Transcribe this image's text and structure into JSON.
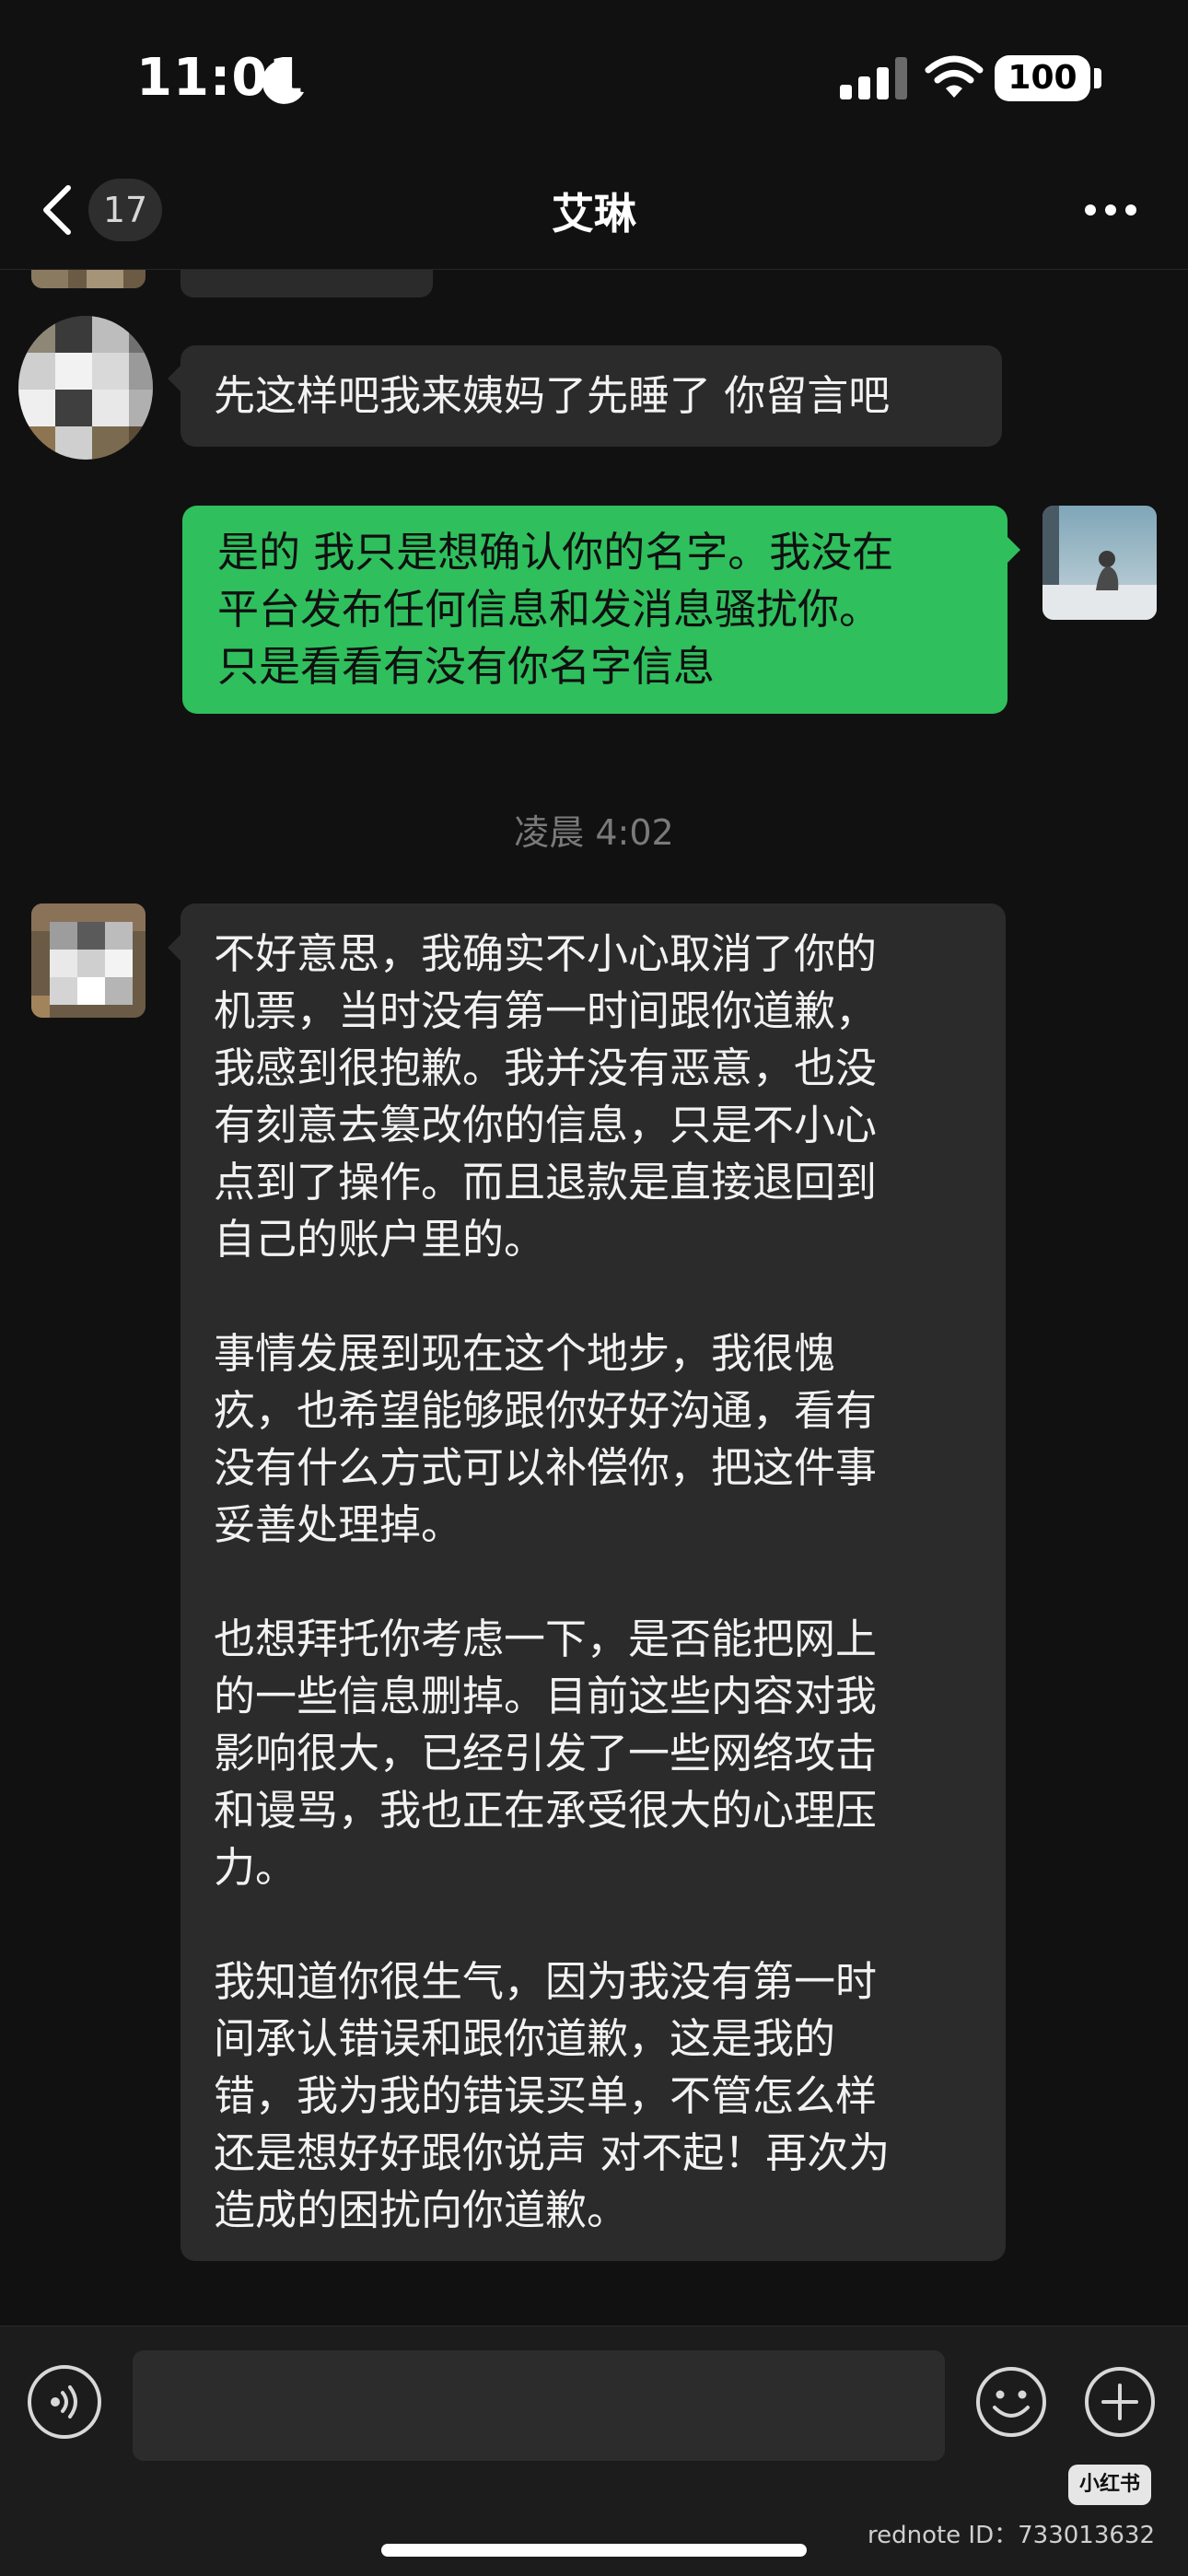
{
  "status_bar": {
    "time": "11:01",
    "battery": "100"
  },
  "nav": {
    "unread_count": "17",
    "title": "艾琳"
  },
  "messages": [
    {
      "from": "contact",
      "text": "先这样吧我来姨妈了先睡了 你留言吧"
    },
    {
      "from": "me",
      "text": "是的 我只是想确认你的名字。我没在\n平台发布任何信息和发消息骚扰你。\n只是看看有没有你名字信息"
    },
    {
      "from": "contact",
      "text": "不好意思，我确实不小心取消了你的\n机票，当时没有第一时间跟你道歉，\n我感到很抱歉。我并没有恶意，也没\n有刻意去篡改你的信息，只是不小心\n点到了操作。而且退款是直接退回到\n自己的账户里的。\n\n事情发展到现在这个地步，我很愧\n疚，也希望能够跟你好好沟通，看有\n没有什么方式可以补偿你，把这件事\n妥善处理掉。\n\n也想拜托你考虑一下，是否能把网上\n的一些信息删掉。目前这些内容对我\n影响很大，已经引发了一些网络攻击\n和谩骂，我也正在承受很大的心理压\n力。\n\n我知道你很生气，因为我没有第一时\n间承认错误和跟你道歉，这是我的\n错，我为我的错误买单，不管怎么样\n还是想好好跟你说声 对不起！再次为\n造成的困扰向你道歉。"
    }
  ],
  "timestamp": "凌晨 4:02",
  "input": {
    "placeholder": ""
  },
  "icons": [
    "moon-icon",
    "signal-icon",
    "wifi-icon",
    "back-chevron-icon",
    "more-icon",
    "voice-icon",
    "emoji-icon",
    "plus-icon"
  ],
  "watermark": {
    "logo": "小红书",
    "text": "rednote ID：733013632"
  },
  "colors": {
    "background": "#111111",
    "incoming_bubble": "#2b2b2b",
    "outgoing_bubble": "#2fbf5d",
    "timestamp": "#7a7a7a"
  }
}
